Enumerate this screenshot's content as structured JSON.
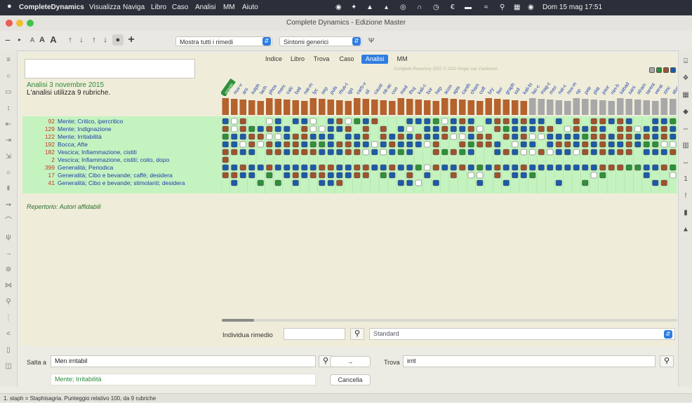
{
  "menubar": {
    "apple": "",
    "app_name": "CompleteDynamics",
    "items": [
      "Visualizza",
      "Naviga",
      "Libro",
      "Caso",
      "Analisi",
      "MM",
      "Aiuto"
    ],
    "clock": "Dom 15 mag  17:51"
  },
  "window": {
    "title": "Complete Dynamics - Edizione Master"
  },
  "toolbar": {
    "minus": "−",
    "font_small": "A",
    "font_mid": "A",
    "font_large": "A",
    "plus": "+",
    "remedy_filter": "Mostra tutti i rimedi",
    "symptom_filter": "Sintomi generici"
  },
  "tabs": [
    "Indice",
    "Libro",
    "Trova",
    "Caso",
    "Analisi",
    "MM"
  ],
  "active_tab": "Analisi",
  "analysis": {
    "title": "Analisi 3 novembre 2015",
    "subtitle": "L'analisi utilizza 9 rubriche.",
    "repertory_header": "Complete Repertory 2022 © 2022 Roger van Zandvoort",
    "repertory_label": "Repertorio: Autori affidabili"
  },
  "rubrics": [
    {
      "count": "92",
      "name": "Mente; Critico, ipercritico"
    },
    {
      "count": "129",
      "name": "Mente; Indignazione"
    },
    {
      "count": "122",
      "name": "Mente; Irritabilità"
    },
    {
      "count": "192",
      "name": "Bocca; Afte"
    },
    {
      "count": "182",
      "name": "Vescica; Infiammazione, cistiti"
    },
    {
      "count": "2",
      "name": "Vescica; Infiammazione, cistiti; coito, dopo"
    },
    {
      "count": "399",
      "name": "Generalità; Periodica"
    },
    {
      "count": "17",
      "name": "Generalità; Cibo e bevande; caffè; desidera"
    },
    {
      "count": "41",
      "name": "Generalità; Cibo e bevande; stimolanti; desidera"
    }
  ],
  "remedies": [
    "staph",
    "nux-v",
    "ars",
    "sulph",
    "lach",
    "phos",
    "merc",
    "calc",
    "bell",
    "nat-m",
    "lyc",
    "sep",
    "puls",
    "rhus-t",
    "ign",
    "carb-v",
    "sil",
    "caust",
    "nit-ac",
    "con",
    "med",
    "thuj",
    "kali-c",
    "bor",
    "hep",
    "acon",
    "apis",
    "canth",
    "cham",
    "coff",
    "bry",
    "ferr",
    "graph",
    "iod",
    "kali-bi",
    "lac-c",
    "mag-c",
    "mez",
    "nat-c",
    "nux-m",
    "op",
    "petr",
    "plat",
    "psor",
    "ran-b",
    "sabad",
    "sars",
    "stram",
    "tarent",
    "verat",
    "zinc",
    "alum"
  ],
  "legend_colors": [
    "#a9a9a9",
    "#2f8f3a",
    "#a0522d",
    "#1d5aa8"
  ],
  "search": {
    "find_remedy_label": "Individua rimedio",
    "find_remedy_value": "",
    "standard_select": "Standard"
  },
  "bottom": {
    "jump_label": "Salta a",
    "jump_value": "Men irritabil",
    "jump_result": "Mente; Irritabilità",
    "arrow_button": "→",
    "cancel_button": "Cancella",
    "find_label": "Trova",
    "find_value": "irrit"
  },
  "status": {
    "text": "1. staph = Staphisagria. Punteggio relativo 100, da 9 rubriche"
  }
}
